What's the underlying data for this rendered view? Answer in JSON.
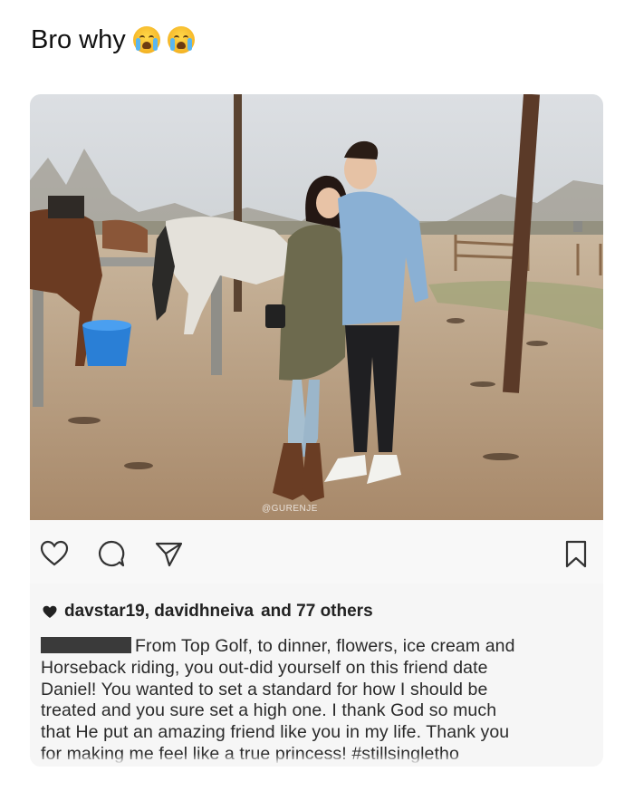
{
  "post": {
    "caption_text": "Bro why",
    "emojis": [
      "crying-face",
      "crying-face"
    ]
  },
  "screenshot": {
    "watermark": "@GURENJE",
    "liked_by": "davstar19, davidhneiva",
    "liked_others": "and 77 others",
    "caption_lines": [
      "From Top Golf, to dinner, flowers, ice cream and",
      "Horseback riding, you out-did yourself on this friend date",
      "Daniel! You wanted to set a standard for how I should be",
      "treated and you sure set a high one. I thank God so much",
      "that He put an amazing friend like you in my life. Thank you",
      "for making me feel like a true princess! #stillsingletho"
    ],
    "icons": [
      "heart-icon",
      "comment-icon",
      "share-icon",
      "bookmark-icon"
    ]
  }
}
